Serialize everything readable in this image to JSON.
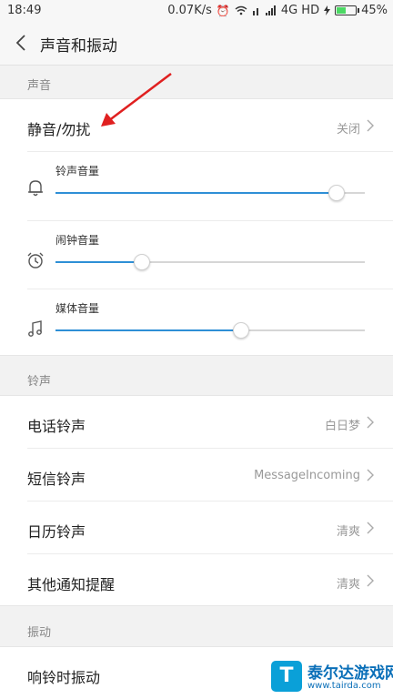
{
  "status_bar": {
    "time": "18:49",
    "network_speed": "0.07K/s",
    "network_type": "4G HD",
    "battery_percent": "45%",
    "battery_level": 0.45,
    "icons": [
      "alarm-icon",
      "wifi-icon",
      "no-signal-icon",
      "signal-icon",
      "charging-icon",
      "battery-icon"
    ]
  },
  "header": {
    "title": "声音和振动",
    "back_icon": "chevron-left-icon"
  },
  "sections": {
    "sound": {
      "label": "声音",
      "mute": {
        "label": "静音/勿扰",
        "value": "关闭"
      },
      "volumes": [
        {
          "label": "铃声音量",
          "icon": "bell-icon",
          "level": 0.91
        },
        {
          "label": "闹钟音量",
          "icon": "alarm-clock-icon",
          "level": 0.28
        },
        {
          "label": "媒体音量",
          "icon": "music-note-icon",
          "level": 0.6
        }
      ]
    },
    "ringtone": {
      "label": "铃声",
      "items": [
        {
          "label": "电话铃声",
          "value": "白日梦"
        },
        {
          "label": "短信铃声",
          "value": "MessageIncoming"
        },
        {
          "label": "日历铃声",
          "value": "清爽"
        },
        {
          "label": "其他通知提醒",
          "value": "清爽"
        }
      ]
    },
    "vibration": {
      "label": "振动",
      "items": [
        {
          "label": "响铃时振动"
        }
      ]
    }
  },
  "annotation": {
    "color": "#e02020"
  },
  "watermark": {
    "title": "泰尔达游戏网",
    "url": "www.tairda.com",
    "logo_char": "T"
  },
  "colors": {
    "accent": "#2e8fd6",
    "background": "#f2f2f2",
    "card": "#ffffff"
  }
}
